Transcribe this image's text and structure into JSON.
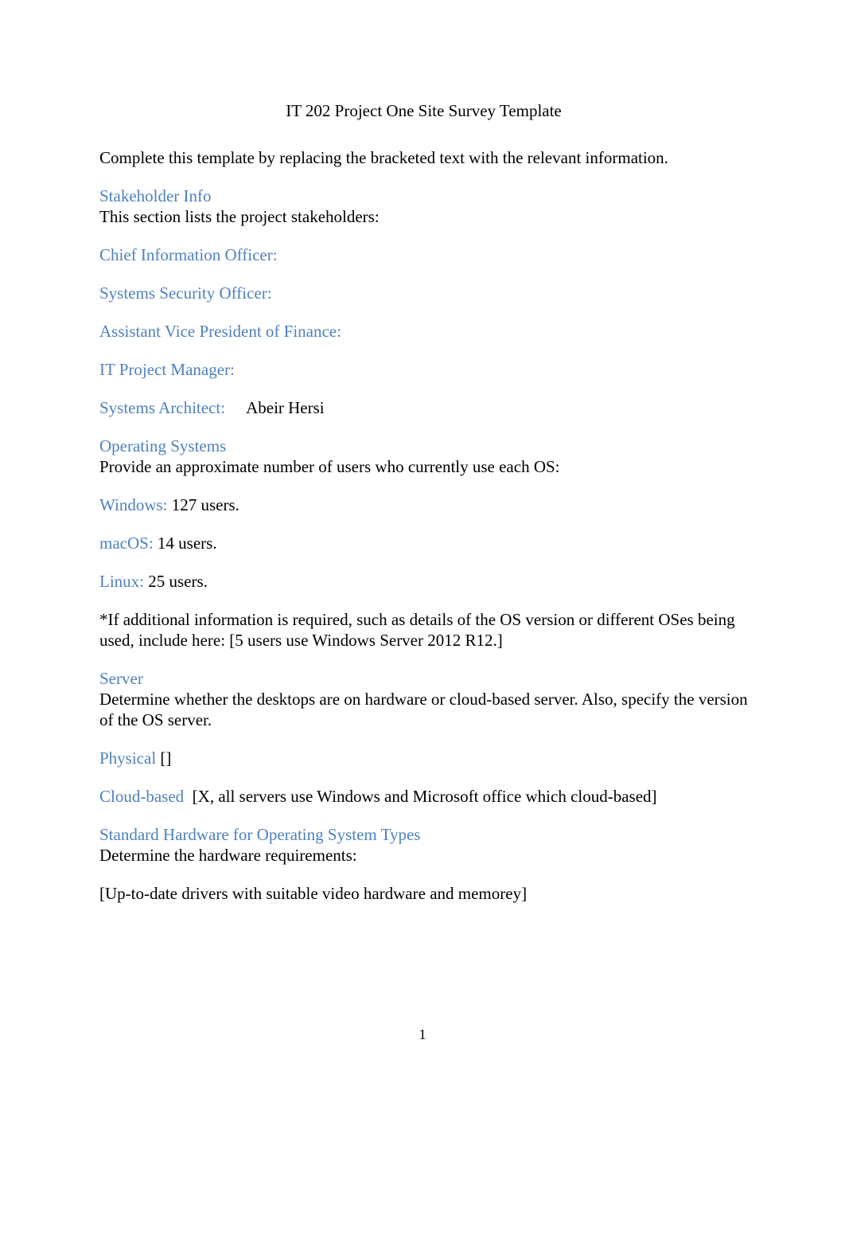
{
  "document": {
    "title": "IT 202 Project One Site Survey Template",
    "intro": "Complete this template by replacing the bracketed text with the relevant information.",
    "page_number": "1",
    "heading_color": "#4F81BD",
    "body_color": "#000000"
  },
  "sections": {
    "stakeholder": {
      "heading": "Stakeholder Info",
      "description": "This section lists the project stakeholders:",
      "fields": [
        {
          "label": "Chief Information Officer:",
          "value": ""
        },
        {
          "label": "Systems Security Officer:",
          "value": ""
        },
        {
          "label": "Assistant Vice President of Finance:",
          "value": ""
        },
        {
          "label": "IT Project Manager:",
          "value": ""
        },
        {
          "label": "Systems Architect:",
          "value": "Abeir Hersi"
        }
      ]
    },
    "operating_systems": {
      "heading": "Operating Systems",
      "description": "Provide an approximate number of users who currently use each OS:",
      "fields": [
        {
          "label": "Windows:",
          "value": "127 users."
        },
        {
          "label": "macOS:",
          "value": "14 users."
        },
        {
          "label": "Linux:",
          "value": "25 users."
        }
      ],
      "note": "*If additional information is required, such as details of the OS version or different OSes being used, include here: [5 users use Windows Server 2012 R12.]"
    },
    "server": {
      "heading": "Server",
      "description": "Determine whether the desktops are on hardware or cloud-based server. Also, specify the version of the OS server.",
      "fields": [
        {
          "label": "Physical",
          "value": "[]"
        },
        {
          "label": "Cloud-based",
          "value": "[X, all servers use Windows and Microsoft office which cloud-based]"
        }
      ]
    },
    "standard_hardware": {
      "heading": "Standard Hardware for Operating System Types",
      "description": "Determine the hardware requirements:",
      "answer": "[Up-to-date drivers with suitable video hardware and memorey]"
    }
  }
}
